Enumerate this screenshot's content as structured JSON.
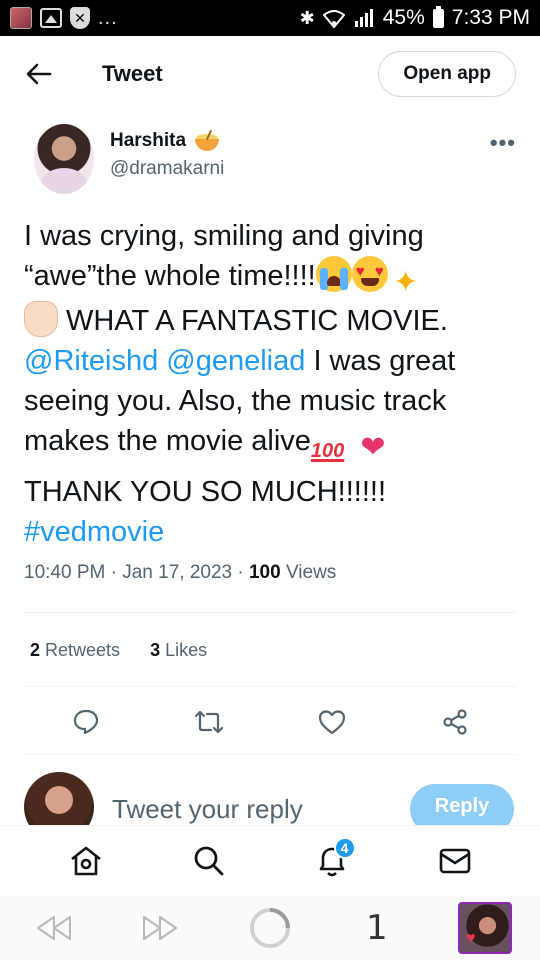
{
  "status_bar": {
    "dots": "...",
    "battery": "45%",
    "time": "7:33 PM"
  },
  "header": {
    "title": "Tweet",
    "open_app": "Open app"
  },
  "tweet": {
    "author_name": "Harshita",
    "author_handle": "@dramakarni",
    "text": {
      "l1": "I was crying, smiling and giving",
      "l2": "“awe”the whole time!!!!",
      "l3": " WHAT A FANTASTIC MOVIE.",
      "l4_mention1": "@Riteishd",
      "l4_mention2": "@geneliad",
      "l4_rest": " I was great",
      "l5": "seeing you. Also, the music track",
      "l6": "makes the movie alive",
      "l7": "THANK YOU SO MUCH!!!!!!",
      "l8": "#vedmovie"
    },
    "time": "10:40 PM",
    "sep": " · ",
    "date": "Jan 17, 2023",
    "views_count": "100",
    "views_label": " Views",
    "retweets_count": "2",
    "retweets_label": " Retweets",
    "likes_count": "3",
    "likes_label": " Likes"
  },
  "reply": {
    "placeholder": "Tweet your reply",
    "button": "Reply"
  },
  "tabbar": {
    "notifications_badge": "4"
  },
  "browser": {
    "tab_count": "1"
  },
  "colors": {
    "accent": "#1d9bf0",
    "reply_button": "#8ecdf7",
    "text": "#0f1419",
    "secondary": "#536471"
  }
}
